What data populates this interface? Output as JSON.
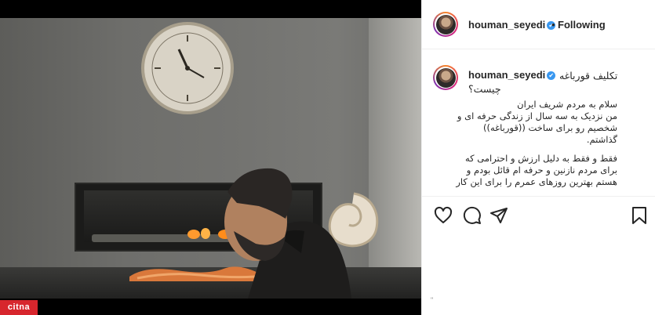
{
  "post": {
    "username": "houman_seyedi",
    "verified_mark": "✔",
    "separator": "•",
    "follow_state": "Following",
    "more_label": "•••"
  },
  "caption": {
    "username": "houman_seyedi",
    "title_part1": "تکلیف قورباغه",
    "title_part2": "چیست؟",
    "lines": [
      "سلام به مردم شریف ایران",
      "من نزدیک به سه سال از زندگی حرفه ای و",
      "شخصیم رو برای ساخت ((قورباغه))",
      "گذاشتم."
    ],
    "lines2": [
      "فقط و فقط به دلیل ارزش و احترامی که",
      "برای مردم نازنین و حرفه ام قائل بودم و",
      "هستم بهترین روزهای عمرم را برای این کار"
    ]
  },
  "actions": {
    "icons": [
      "heart-icon",
      "comment-icon",
      "share-icon",
      "bookmark-icon"
    ]
  },
  "photo": {
    "watermark": "citna"
  },
  "footer": {
    "mark": "\""
  },
  "colors": {
    "accent_blue": "#3897f0",
    "text": "#262626",
    "watermark_red": "#d7262d"
  }
}
